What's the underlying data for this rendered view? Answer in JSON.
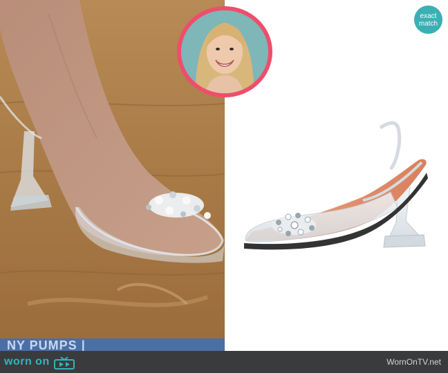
{
  "badge": {
    "line1": "exact",
    "line2": "match"
  },
  "tv_banner": {
    "text": "NY PUMPS |"
  },
  "footer": {
    "logo_text": "worn on",
    "site": "WornOnTV.net"
  },
  "colors": {
    "accent": "#2fb6bd",
    "ring": "#ee4e6b",
    "footer_bg": "#3a3b3d",
    "banner": "#4a6fa5",
    "sole": "#e08a6a"
  },
  "images": {
    "left": "close-up of foot wearing clear pointed slingback pump with crystal embellishment on wooden floor",
    "avatar": "circular headshot of smiling blonde woman",
    "right": "product shot of clear PVC slingback pump with crystal brooch and flared heel"
  }
}
